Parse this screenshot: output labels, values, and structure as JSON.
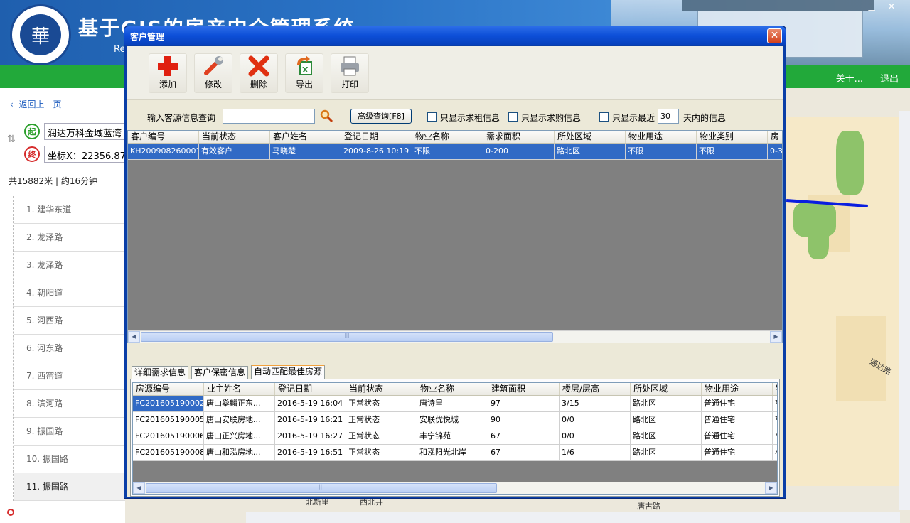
{
  "app": {
    "title": "基于GIS的房产中介管理系统",
    "subtitle": "Re",
    "logo_char": "華",
    "minimize_label": "▁",
    "close_label": "✕"
  },
  "nav": {
    "about": "关于...",
    "exit": "退出"
  },
  "route": {
    "back": "返回上一页",
    "start_badge": "起",
    "end_badge": "终",
    "start": "润达万科金域蓝湾",
    "end": "坐标X：22356.87",
    "summary": "共15882米 | 约16分钟",
    "steps": [
      "1. 建华东道",
      "2. 龙泽路",
      "3. 龙泽路",
      "4. 朝阳道",
      "5. 河西路",
      "6. 河东路",
      "7. 西窑道",
      "8. 滨河路",
      "9. 振国路",
      "10. 振国路",
      "11. 振国路"
    ],
    "active_step": 10
  },
  "map": {
    "labels": [
      "北新里",
      "西北井",
      "唐古路",
      "通达路"
    ]
  },
  "dialog": {
    "title": "客户管理",
    "toolbar": [
      {
        "label": "添加",
        "icon": "add-icon"
      },
      {
        "label": "修改",
        "icon": "wrench-icon"
      },
      {
        "label": "删除",
        "icon": "delete-icon"
      },
      {
        "label": "导出",
        "icon": "excel-export-icon"
      },
      {
        "label": "打印",
        "icon": "printer-icon"
      }
    ],
    "search": {
      "label": "输入客源信息查询",
      "value": "",
      "advanced": "高级查询[F8]",
      "rent_only": "只显示求租信息",
      "buy_only": "只显示求购信息",
      "recent_prefix": "只显示最近",
      "recent_days": "30",
      "recent_suffix": "天内的信息"
    },
    "customers": {
      "columns": [
        "客户编号",
        "当前状态",
        "客户姓名",
        "登记日期",
        "物业名称",
        "需求面积",
        "所处区域",
        "物业用途",
        "物业类别",
        "房"
      ],
      "rows": [
        [
          "KH200908260001",
          "有效客户",
          "马晓楚",
          "2009-8-26 10:19",
          "不限",
          "0-200",
          "路北区",
          "不限",
          "不限",
          "0-3"
        ]
      ]
    },
    "tabs": [
      "详细需求信息",
      "客户保密信息",
      "自动匹配最佳房源"
    ],
    "active_tab": 2,
    "houses": {
      "columns": [
        "房源编号",
        "业主姓名",
        "登记日期",
        "当前状态",
        "物业名称",
        "建筑面积",
        "楼层/层高",
        "所处区域",
        "物业用途",
        "物"
      ],
      "rows": [
        [
          "FC201605190002",
          "唐山燊麟正东...",
          "2016-5-19 16:04",
          "正常状态",
          "唐诗里",
          "97",
          "3/15",
          "路北区",
          "普通住宅",
          "高"
        ],
        [
          "FC201605190005",
          "唐山安联房地...",
          "2016-5-19 16:21",
          "正常状态",
          "安联优悦城",
          "90",
          "0/0",
          "路北区",
          "普通住宅",
          "高"
        ],
        [
          "FC201605190006",
          "唐山正兴房地...",
          "2016-5-19 16:27",
          "正常状态",
          "丰宁锦苑",
          "67",
          "0/0",
          "路北区",
          "普通住宅",
          "高"
        ],
        [
          "FC201605190008",
          "唐山和泓房地...",
          "2016-5-19 16:51",
          "正常状态",
          "和泓阳光北岸",
          "67",
          "1/6",
          "路北区",
          "普通住宅",
          "小"
        ]
      ]
    },
    "scroll_left": "◀",
    "scroll_right": "▶",
    "scroll_grip": "|||"
  }
}
